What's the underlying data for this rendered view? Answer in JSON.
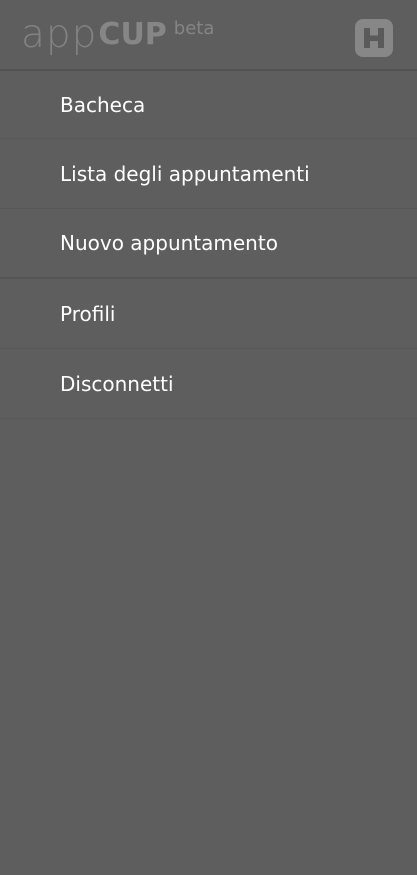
{
  "header": {
    "logo_app": "app",
    "logo_cup": "CUP",
    "logo_beta": "beta",
    "icon": "h-letter-icon"
  },
  "menu": {
    "items": [
      {
        "label": "Bacheca"
      },
      {
        "label": "Lista degli appuntamenti"
      },
      {
        "label": "Nuovo appuntamento"
      },
      {
        "label": "Profili"
      },
      {
        "label": "Disconnetti"
      }
    ]
  },
  "colors": {
    "background": "#5e5e5e",
    "logo_text": "#858585",
    "icon_bg": "#878787",
    "menu_text": "#ffffff"
  }
}
